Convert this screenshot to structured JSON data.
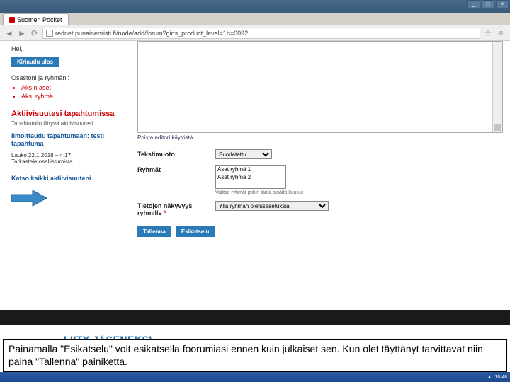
{
  "chrome": {
    "tab_title": "Suomen Pocket",
    "url": "rednet.punainenristi.fi/node/add/forum?gids_product_level=1b=0092",
    "min": "_",
    "max": "□",
    "close": "×"
  },
  "sidebar": {
    "greeting": "Hei,",
    "logout_btn": "Kirjaudu ulos",
    "groups_label": "Osastoni ja ryhmäni:",
    "items": [
      "Aks.n aset",
      "Aks. ryhmä"
    ],
    "akt_title": "Aktiivisuutesi tapahtumissa",
    "akt_sub": "Tapahtumiin liittyvä aktiivisuutesi",
    "evt_link": "Ilmoittaudu tapahtumaan: testi tapahtuma",
    "evt_date": "Lauko 22.1.2018 – 4:17",
    "evt_view": "Tarkastele osallistumista",
    "all_link": "Katso kaikki aktiivisuuteni"
  },
  "main": {
    "toggle_editor": "Poista editori käytöstä",
    "fmt_label": "Tekstimuoto",
    "fmt_value": "Suodatettu",
    "groups_label": "Ryhmät",
    "groups_options": [
      "Aset ryhmä 1",
      "Aset ryhmä 2"
    ],
    "groups_hint": "Valitse ryhmät joihin tämä sisältö kuuluu",
    "vis_label": "Tietojen näkyvyys ryhmille",
    "vis_value": "Yllä ryhmän oletusasetuksia",
    "save_btn": "Tallenna",
    "preview_btn": "Esikatselu"
  },
  "join": {
    "title": "LIITY JÄSENEKSI"
  },
  "caption": {
    "text": "Painamalla \"Esikatselu\" voit esikatsella foorumiasi ennen kuin julkaiset sen. Kun olet täyttänyt tarvittavat niin paina \"Tallenna\" painiketta."
  },
  "taskbar": {
    "time": "10:48"
  }
}
